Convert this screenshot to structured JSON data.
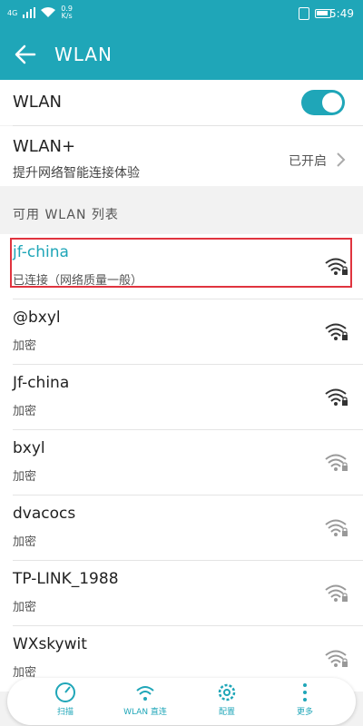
{
  "status_bar": {
    "network": "4G",
    "speed_value": "0.9",
    "speed_unit": "K/s",
    "battery": "60",
    "time": "5:49"
  },
  "header": {
    "title": "WLAN"
  },
  "wlan": {
    "label": "WLAN",
    "enabled": true
  },
  "wlan_plus": {
    "label": "WLAN+",
    "subtitle": "提升网络智能连接体验",
    "state": "已开启"
  },
  "list_header": "可用 WLAN 列表",
  "networks": [
    {
      "name": "jf-china",
      "status": "已连接（网络质量一般）",
      "connected": true
    },
    {
      "name": "@bxyl",
      "status": "加密"
    },
    {
      "name": "Jf-china",
      "status": "加密"
    },
    {
      "name": "bxyl",
      "status": "加密"
    },
    {
      "name": "dvacocs",
      "status": "加密"
    },
    {
      "name": "TP-LINK_1988",
      "status": "加密"
    },
    {
      "name": "WXskywit",
      "status": "加密"
    }
  ],
  "bottom_bar": {
    "scan": "扫描",
    "direct": "WLAN 直连",
    "config": "配置",
    "more": "更多"
  },
  "colors": {
    "accent": "#1fa6b8",
    "highlight": "#e0343f"
  }
}
